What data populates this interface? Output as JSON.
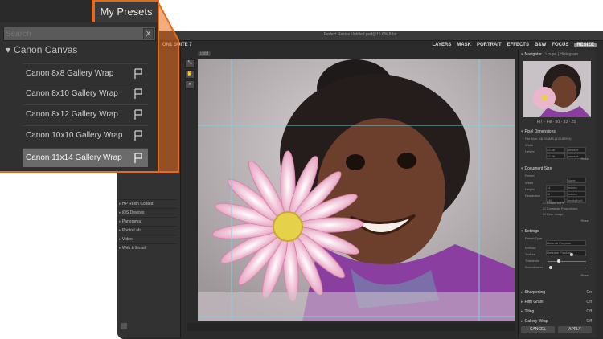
{
  "app": {
    "title": "Perfect Resize Untitled.psd@15.6% 8-bit",
    "brand": "ON1 SUITE 7",
    "modules": [
      "LAYERS",
      "MASK",
      "PORTRAIT",
      "EFFECTS",
      "B&W",
      "FOCUS"
    ],
    "modules_active": "RESIZE",
    "image_tab": "child",
    "left_categories": [
      "HP Resin Coated",
      "iOS Devices",
      "Panorama",
      "Photo Lab",
      "Video",
      "Web & Email"
    ]
  },
  "right_panel": {
    "navigator": {
      "title": "Navigator",
      "tabs": "Loupe | Histogram",
      "zoom_levels": "FIT · Fill · 50 · 33 · 25"
    },
    "pixel_dimensions": {
      "title": "Pixel Dimensions",
      "file_size": "File Size: 48.768MB (133.895%)",
      "width_label": "Width",
      "width_value": "22.86",
      "width_unit": "percent",
      "height_label": "Height",
      "height_value": "22.86",
      "height_unit": "percent",
      "reset": "Reset"
    },
    "document_size": {
      "title": "Document Size",
      "preset_label": "Preset",
      "preset_value": "None",
      "width_label": "Width",
      "width_value": "14",
      "width_unit": "inches",
      "height_label": "Height",
      "height_value": "11",
      "height_unit": "inches",
      "resolution_label": "Resolution",
      "resolution_value": "240",
      "resolution_unit": "pixels/inch",
      "rotate": "Rotate to Fit",
      "constrain": "Constrain Proportions",
      "crop": "Crop Image",
      "reset": "Reset"
    },
    "settings": {
      "title": "Settings",
      "preset_type_label": "Preset Type",
      "preset_type_value": "General Purpose",
      "method_label": "Method",
      "method_value": "Genuine Fractals",
      "texture_label": "Texture",
      "threshold_label": "Threshold",
      "smoothness_label": "Smoothness",
      "reset": "Reset"
    },
    "collapsed": [
      {
        "title": "Sharpening",
        "state": "On"
      },
      {
        "title": "Film Grain",
        "state": "Off"
      },
      {
        "title": "Tiling",
        "state": "Off"
      },
      {
        "title": "Gallery Wrap",
        "state": "Off"
      }
    ],
    "cancel": "CANCEL",
    "apply": "APPLY"
  },
  "overlay": {
    "tab_label": "My Presets",
    "search_placeholder": "Search",
    "clear_label": "X",
    "group_label": "Canon Canvas",
    "presets": [
      "Canon 8x8 Gallery Wrap",
      "Canon 8x10 Gallery Wrap",
      "Canon 8x12 Gallery Wrap",
      "Canon 10x10 Gallery Wrap",
      "Canon 11x14 Gallery Wrap"
    ],
    "selected_index": 4
  },
  "colors": {
    "accent": "#e56a1a",
    "panel": "#303030",
    "selected": "#6b6b6b"
  }
}
